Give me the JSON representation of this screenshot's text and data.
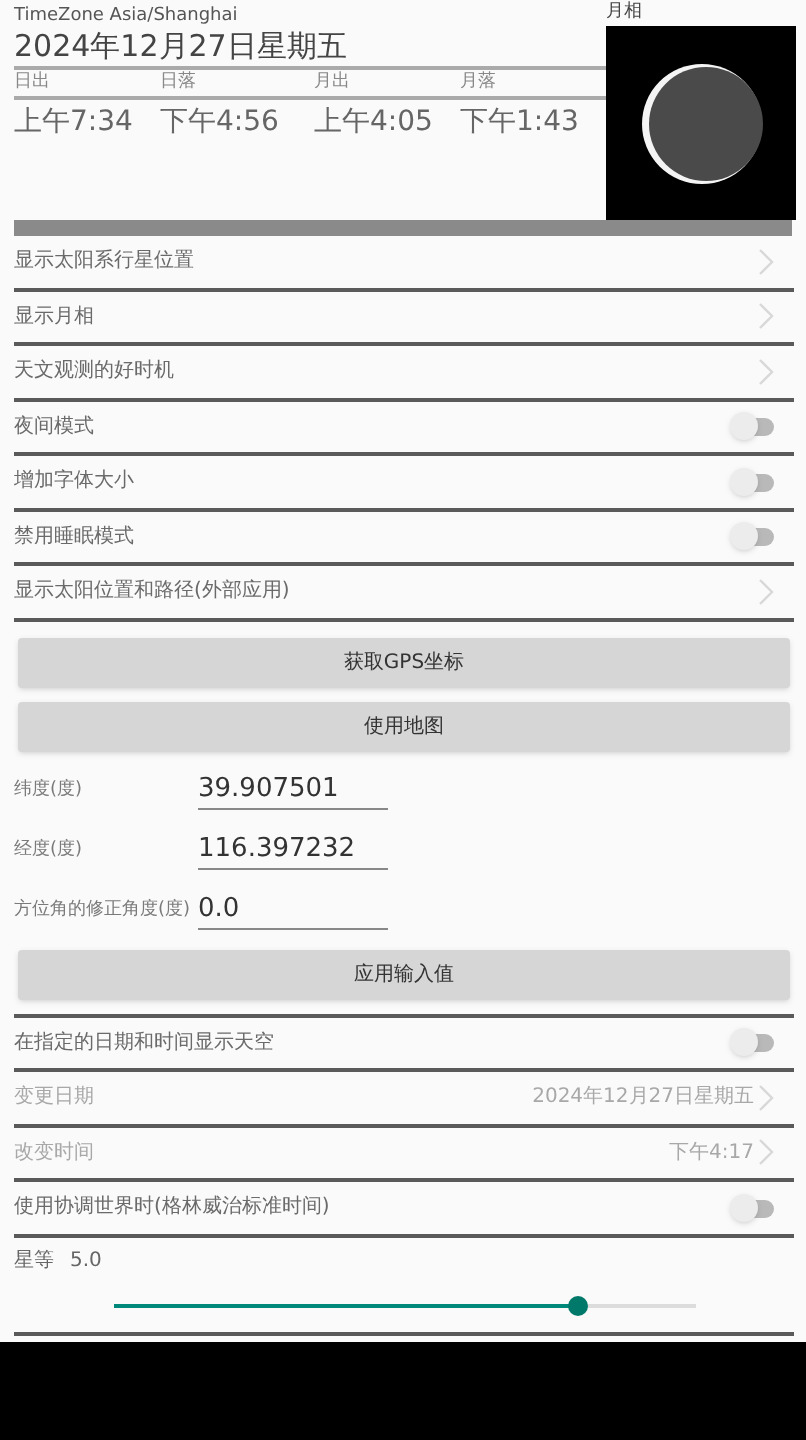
{
  "header": {
    "timezone": "TimeZone Asia/Shanghai",
    "date": "2024年12月27日星期五",
    "times": [
      {
        "label": "日出",
        "value": "上午7:34"
      },
      {
        "label": "日落",
        "value": "下午4:56"
      },
      {
        "label": "月出",
        "value": "上午4:05"
      },
      {
        "label": "月落",
        "value": "下午1:43"
      }
    ],
    "moon_label": "月相"
  },
  "menu": [
    {
      "kind": "link",
      "label": "显示太阳系行星位置"
    },
    {
      "kind": "link",
      "label": "显示月相"
    },
    {
      "kind": "link",
      "label": "天文观测的好时机"
    },
    {
      "kind": "switch",
      "label": "夜间模式",
      "on": false
    },
    {
      "kind": "switch",
      "label": "增加字体大小",
      "on": false
    },
    {
      "kind": "switch",
      "label": "禁用睡眠模式",
      "on": false
    },
    {
      "kind": "link",
      "label": "显示太阳位置和路径(外部应用)"
    }
  ],
  "location": {
    "buttons": [
      "获取GPS坐标",
      "使用地图"
    ],
    "fields": [
      {
        "label": "纬度(度)",
        "value": "39.907501"
      },
      {
        "label": "经度(度)",
        "value": "116.397232"
      },
      {
        "label": "方位角的修正角度(度)",
        "value": "0.0"
      }
    ],
    "apply_button": "应用输入值"
  },
  "sky": [
    {
      "kind": "switch",
      "label": "在指定的日期和时间显示天空",
      "on": false,
      "disabled": false
    },
    {
      "kind": "value",
      "label": "变更日期",
      "value": "2024年12月27日星期五",
      "disabled": true
    },
    {
      "kind": "value",
      "label": "改变时间",
      "value": "下午4:17",
      "disabled": true
    },
    {
      "kind": "switch",
      "label": "使用协调世界时(格林威治标准时间)",
      "on": false,
      "disabled": false
    }
  ],
  "magnitude": {
    "label": "星等",
    "reading": "5.0",
    "level": 0.8
  }
}
